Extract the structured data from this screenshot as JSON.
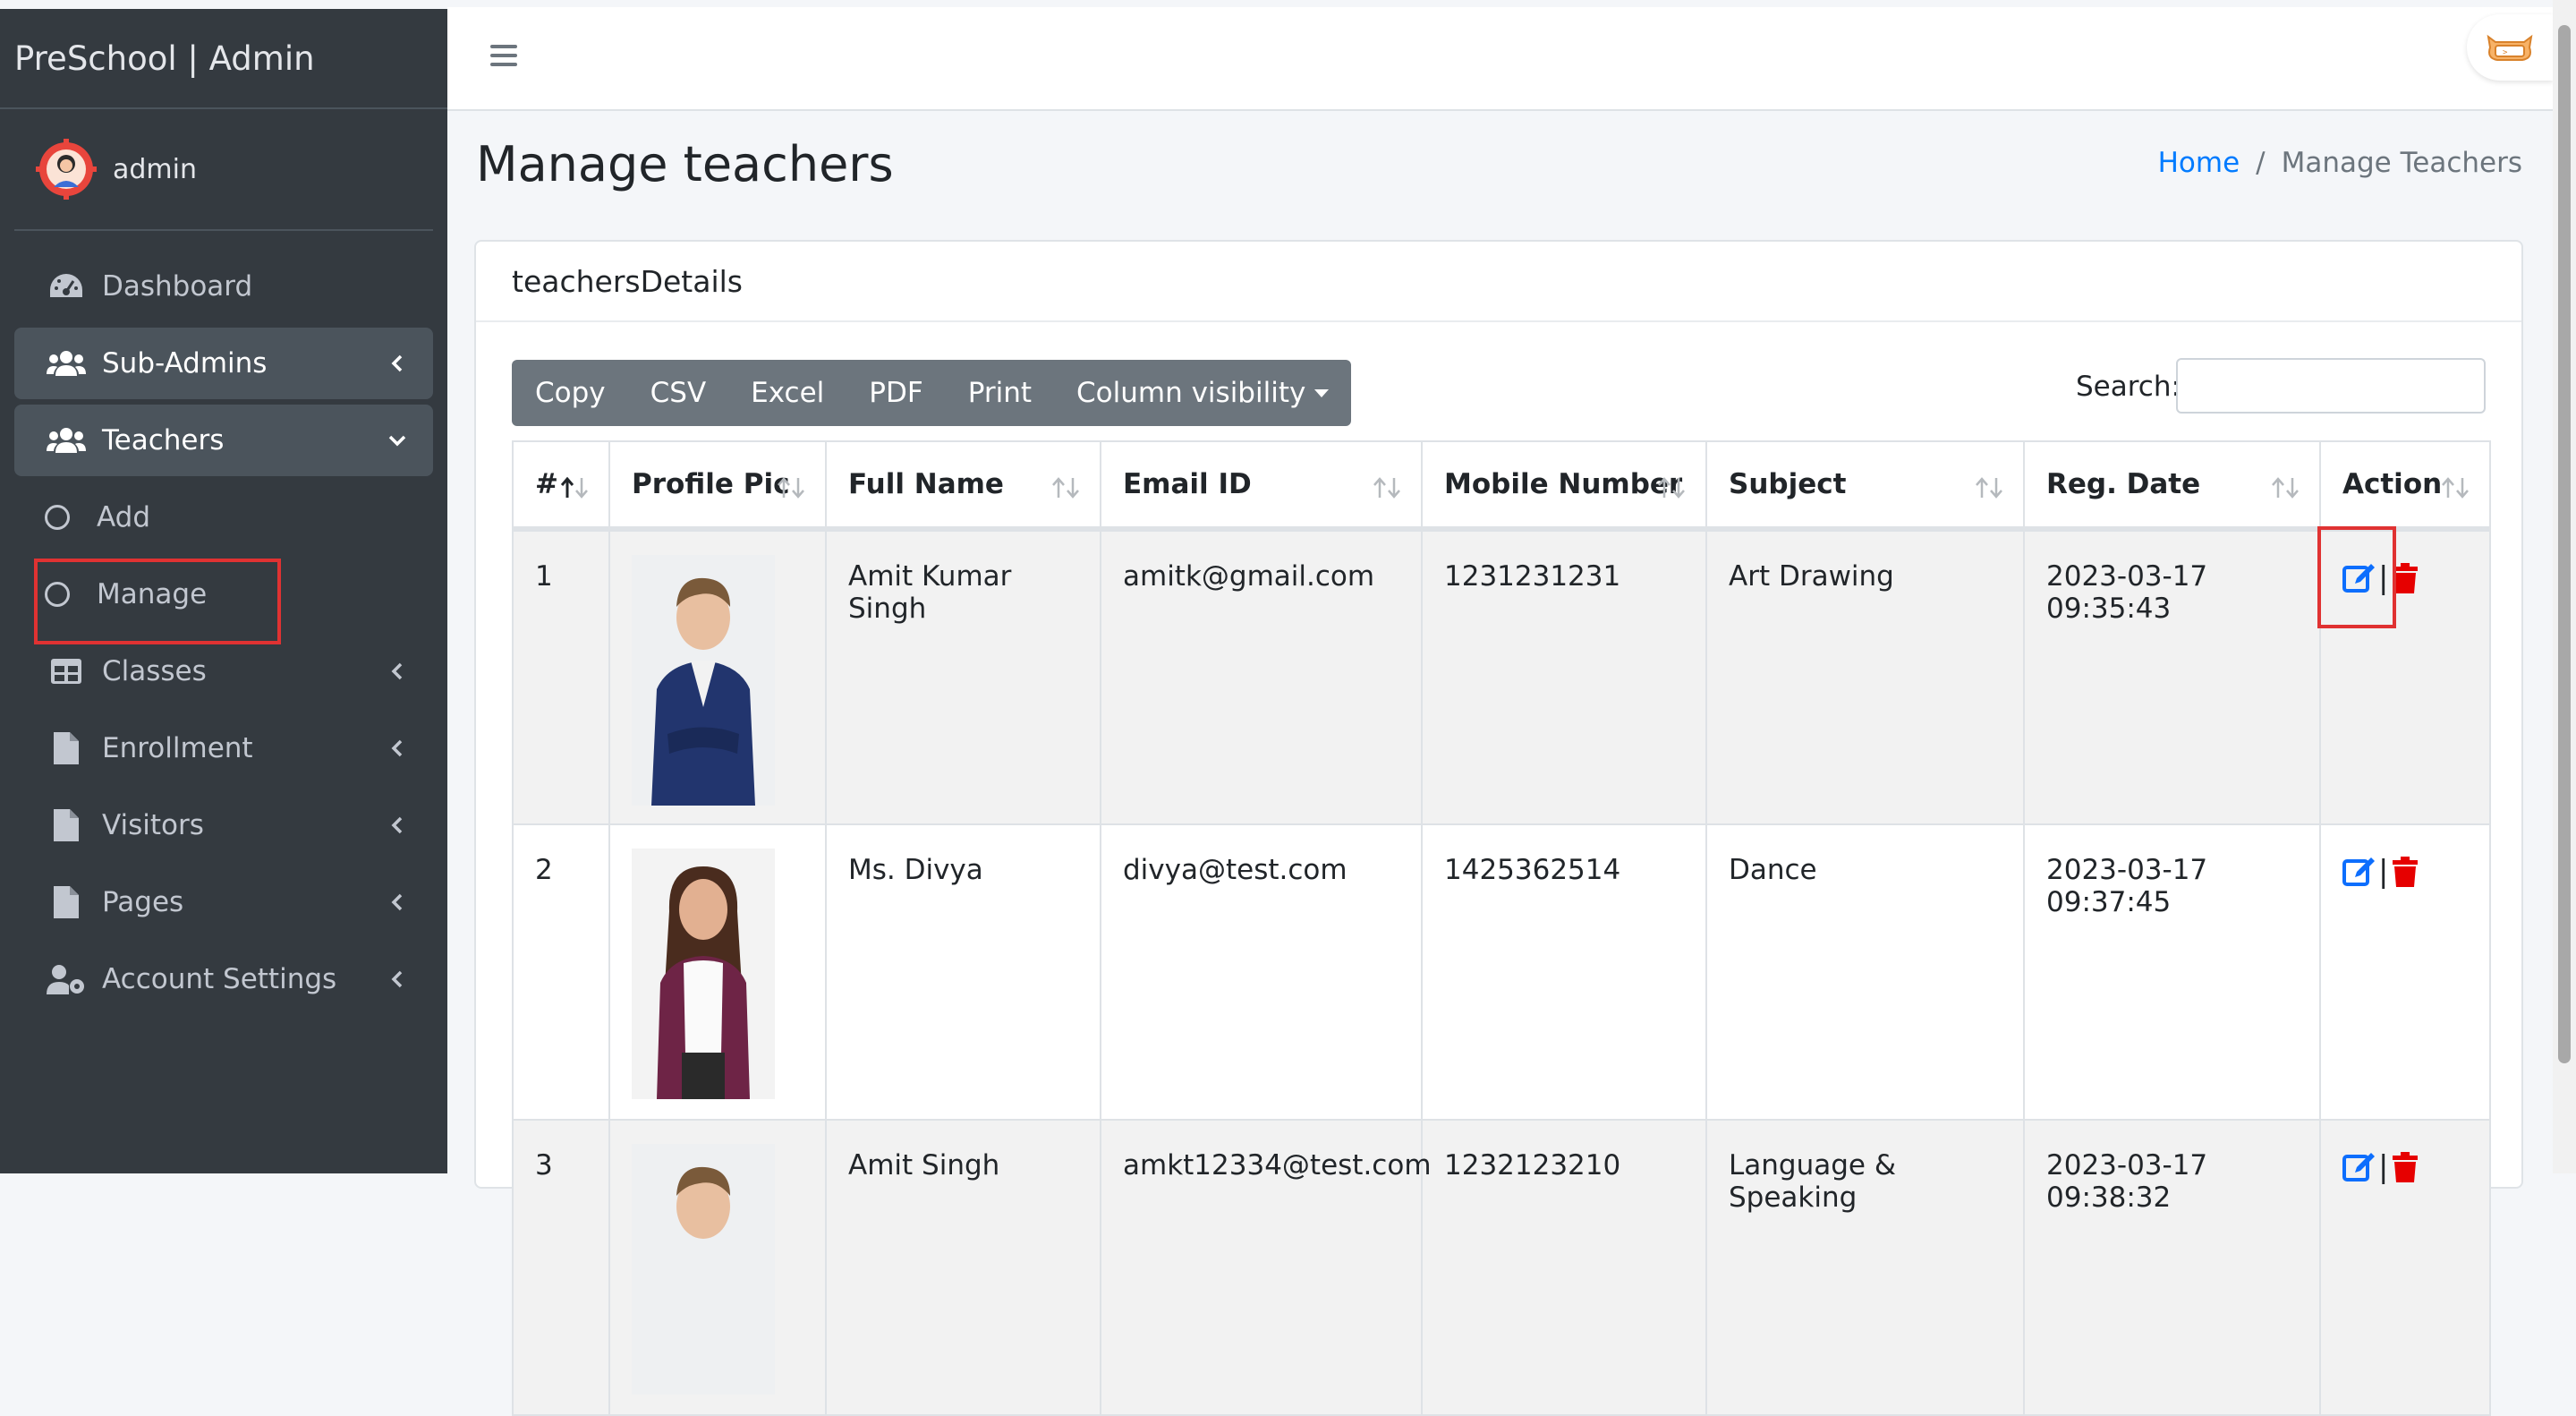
{
  "app": {
    "brand": "PreSchool | Admin",
    "user": "admin"
  },
  "sidebar": {
    "items": [
      {
        "label": "Dashboard",
        "icon": "dashboard-icon"
      },
      {
        "label": "Sub-Admins",
        "icon": "users-icon"
      },
      {
        "label": "Teachers",
        "icon": "users-icon"
      },
      {
        "label": "Add",
        "icon": "circle-icon"
      },
      {
        "label": "Manage",
        "icon": "circle-icon"
      },
      {
        "label": "Classes",
        "icon": "table-icon"
      },
      {
        "label": "Enrollment",
        "icon": "file-icon"
      },
      {
        "label": "Visitors",
        "icon": "file-icon"
      },
      {
        "label": "Pages",
        "icon": "file-icon"
      },
      {
        "label": "Account Settings",
        "icon": "user-gear-icon"
      }
    ]
  },
  "page": {
    "title": "Manage teachers",
    "breadcrumb": {
      "home": "Home",
      "separator": "/",
      "current": "Manage Teachers"
    }
  },
  "card": {
    "title": "teachersDetails",
    "buttons": {
      "copy": "Copy",
      "csv": "CSV",
      "excel": "Excel",
      "pdf": "PDF",
      "print": "Print",
      "colvis": "Column visibility"
    },
    "search_label": "Search:",
    "search_value": ""
  },
  "table": {
    "headers": [
      "#",
      "Profile Pic",
      "Full Name",
      "Email ID",
      "Mobile Number",
      "Subject",
      "Reg. Date",
      "Action"
    ],
    "rows": [
      {
        "num": "1",
        "name": "Amit Kumar Singh",
        "email": "amitk@gmail.com",
        "mobile": "1231231231",
        "subject": "Art Drawing",
        "date": "2023-03-17 09:35:43"
      },
      {
        "num": "2",
        "name": "Ms. Divya",
        "email": "divya@test.com",
        "mobile": "1425362514",
        "subject": "Dance",
        "date": "2023-03-17 09:37:45"
      },
      {
        "num": "3",
        "name": "Amit Singh",
        "email": "amkt12334@test.com",
        "mobile": "1232123210",
        "subject": "Language & Speaking",
        "date": "2023-03-17 09:38:32"
      }
    ]
  },
  "colors": {
    "sidebar": "#343a40",
    "link": "#007bff",
    "danger": "#e60000",
    "highlight": "#e03232"
  }
}
